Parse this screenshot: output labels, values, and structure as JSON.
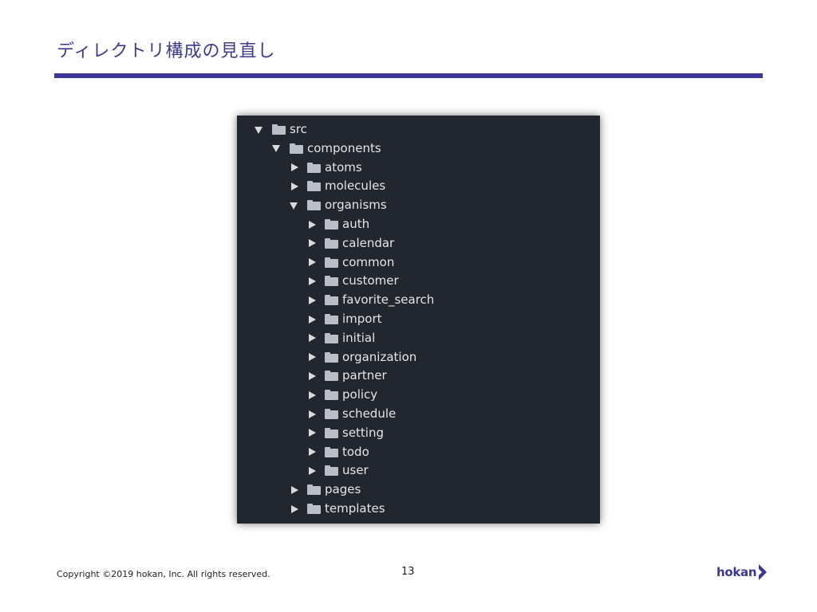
{
  "slide": {
    "title": "ディレクトリ構成の見直し",
    "accent_color": "#3c3696",
    "copyright": "Copyright ©2019 hokan, Inc. All rights reserved.",
    "page_number": "13",
    "logo_text": "hokan"
  },
  "tree": {
    "background": "#22262e",
    "items": [
      {
        "name": "src",
        "expanded": true,
        "depth": 0,
        "icon": "folder-icon"
      },
      {
        "name": "components",
        "expanded": true,
        "depth": 1,
        "icon": "folder-icon"
      },
      {
        "name": "atoms",
        "expanded": false,
        "depth": 2,
        "icon": "folder-icon"
      },
      {
        "name": "molecules",
        "expanded": false,
        "depth": 2,
        "icon": "folder-icon"
      },
      {
        "name": "organisms",
        "expanded": true,
        "depth": 2,
        "icon": "folder-icon"
      },
      {
        "name": "auth",
        "expanded": false,
        "depth": 3,
        "icon": "folder-icon"
      },
      {
        "name": "calendar",
        "expanded": false,
        "depth": 3,
        "icon": "folder-icon"
      },
      {
        "name": "common",
        "expanded": false,
        "depth": 3,
        "icon": "folder-icon"
      },
      {
        "name": "customer",
        "expanded": false,
        "depth": 3,
        "icon": "folder-icon"
      },
      {
        "name": "favorite_search",
        "expanded": false,
        "depth": 3,
        "icon": "folder-icon"
      },
      {
        "name": "import",
        "expanded": false,
        "depth": 3,
        "icon": "folder-icon"
      },
      {
        "name": "initial",
        "expanded": false,
        "depth": 3,
        "icon": "folder-icon"
      },
      {
        "name": "organization",
        "expanded": false,
        "depth": 3,
        "icon": "folder-icon"
      },
      {
        "name": "partner",
        "expanded": false,
        "depth": 3,
        "icon": "folder-icon"
      },
      {
        "name": "policy",
        "expanded": false,
        "depth": 3,
        "icon": "folder-icon"
      },
      {
        "name": "schedule",
        "expanded": false,
        "depth": 3,
        "icon": "folder-icon"
      },
      {
        "name": "setting",
        "expanded": false,
        "depth": 3,
        "icon": "folder-icon"
      },
      {
        "name": "todo",
        "expanded": false,
        "depth": 3,
        "icon": "folder-icon"
      },
      {
        "name": "user",
        "expanded": false,
        "depth": 3,
        "icon": "folder-icon"
      },
      {
        "name": "pages",
        "expanded": false,
        "depth": 2,
        "icon": "folder-icon"
      },
      {
        "name": "templates",
        "expanded": false,
        "depth": 2,
        "icon": "folder-icon"
      }
    ]
  }
}
